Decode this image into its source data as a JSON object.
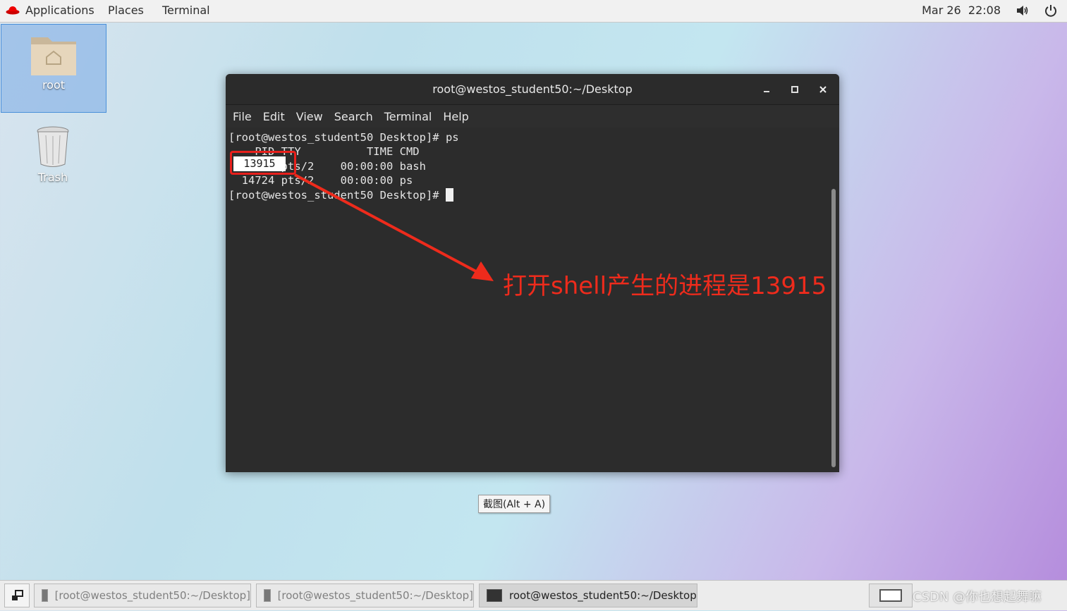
{
  "top_bar": {
    "applications": "Applications",
    "places": "Places",
    "terminal": "Terminal",
    "datetime": "Mar 26  22:08"
  },
  "desktop": {
    "icons": [
      {
        "label": "root"
      },
      {
        "label": "Trash"
      }
    ]
  },
  "terminal": {
    "title": "root@westos_student50:~/Desktop",
    "menu": [
      "File",
      "Edit",
      "View",
      "Search",
      "Terminal",
      "Help"
    ],
    "lines": [
      "[root@westos_student50 Desktop]# ps",
      "    PID TTY          TIME CMD",
      "  13915 pts/2    00:00:00 bash",
      "  14724 pts/2    00:00:00 ps",
      "[root@westos_student50 Desktop]# "
    ],
    "highlight_pid": "13915"
  },
  "annotation": "打开shell产生的进程是13915",
  "tooltip": "截图(Alt + A)",
  "taskbar": {
    "windows": [
      {
        "label": "[root@westos_student50:~/Desktop]"
      },
      {
        "label": "[root@westos_student50:~/Desktop]"
      },
      {
        "label": "root@westos_student50:~/Desktop"
      }
    ]
  },
  "watermark": "CSDN @你也想起舞嘛",
  "colors": {
    "annotation_red": "#ee2b1c",
    "terminal_bg": "#2c2c2c"
  }
}
